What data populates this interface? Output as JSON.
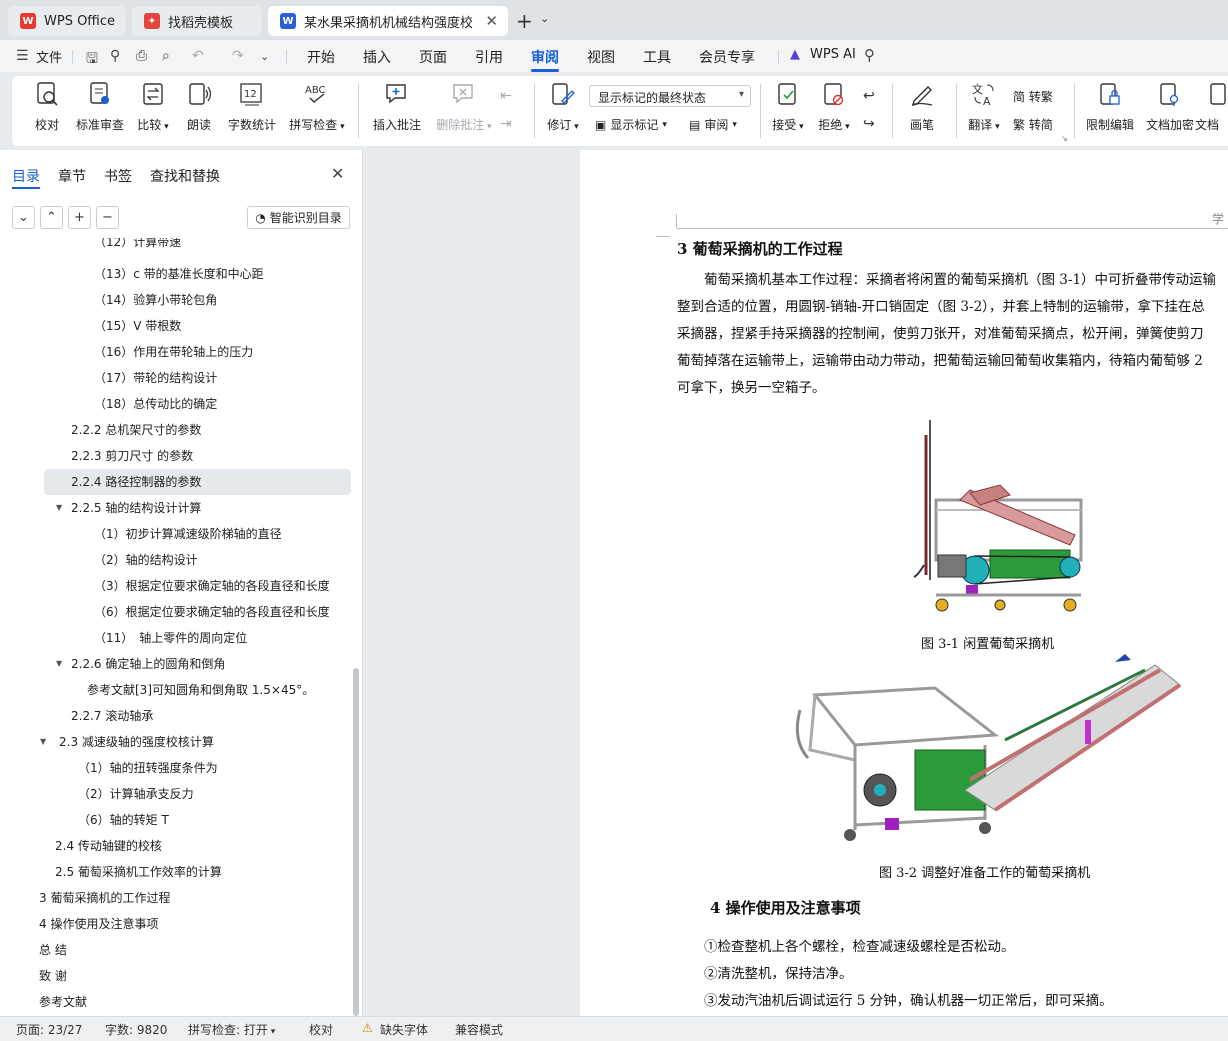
{
  "tabs": [
    {
      "label": "WPS Office",
      "icon": "wps-logo-icon"
    },
    {
      "label": "找稻壳模板",
      "icon": "docer-icon"
    },
    {
      "label": "某水果采摘机机械结构强度校核...",
      "icon": "word-doc-icon"
    }
  ],
  "menu": {
    "file": "文件",
    "items": [
      "开始",
      "插入",
      "页面",
      "引用",
      "审阅",
      "视图",
      "工具",
      "会员专享"
    ],
    "active": "审阅",
    "wps_ai": "WPS AI"
  },
  "ribbon": {
    "proofread": "校对",
    "std_review": "标准审查",
    "compare": "比较",
    "read_aloud": "朗读",
    "word_count": "字数统计",
    "spell_check": "拼写检查",
    "insert_comment": "插入批注",
    "delete_comment": "删除批注",
    "revise": "修订",
    "markup_state": "显示标记的最终状态",
    "show_markup": "显示标记",
    "review": "审阅",
    "accept": "接受",
    "reject": "拒绝",
    "pen": "画笔",
    "translate": "翻译",
    "to_trad": "简 转繁",
    "to_simp": "繁 转简",
    "restrict_edit": "限制编辑",
    "doc_encrypt": "文档加密",
    "doc_more": "文档"
  },
  "nav": {
    "tabs": [
      "目录",
      "章节",
      "书签",
      "查找和替换"
    ],
    "active_tab": "目录",
    "ai_toc": "智能识别目录",
    "toc": [
      {
        "text": "（12）计算带速",
        "level": 3
      },
      {
        "text": "（13）c 带的基准长度和中心距",
        "level": 3
      },
      {
        "text": "（14）验算小带轮包角",
        "level": 3
      },
      {
        "text": "（15）V 带根数",
        "level": 3
      },
      {
        "text": "（16）作用在带轮轴上的压力",
        "level": 3
      },
      {
        "text": "（17）带轮的结构设计",
        "level": 3
      },
      {
        "text": "（18）总传动比的确定",
        "level": 3
      },
      {
        "text": "2.2.2 总机架尺寸的参数",
        "level": 2
      },
      {
        "text": "2.2.3 剪刀尺寸 的参数",
        "level": 2
      },
      {
        "text": "2.2.4 路径控制器的参数",
        "level": 2,
        "selected": true
      },
      {
        "text": "2.2.5 轴的结构设计计算",
        "level": 2,
        "expanded": true
      },
      {
        "text": "（1）初步计算减速级阶梯轴的直径",
        "level": 3
      },
      {
        "text": "（2）轴的结构设计",
        "level": 3
      },
      {
        "text": "（3）根据定位要求确定轴的各段直径和长度",
        "level": 3
      },
      {
        "text": "（6）根据定位要求确定轴的各段直径和长度",
        "level": 3
      },
      {
        "text": "（11）　轴上零件的周向定位",
        "level": 3
      },
      {
        "text": "2.2.6  确定轴上的圆角和倒角",
        "level": 2,
        "expanded": true
      },
      {
        "text": "参考文献[3]可知圆角和倒角取 1.5×45°。",
        "level": "2b"
      },
      {
        "text": "2.2.7 滚动轴承",
        "level": 2
      },
      {
        "text": "2.3 减速级轴的强度校核计算",
        "level": 1,
        "expanded": true
      },
      {
        "text": "（1）轴的扭转强度条件为",
        "level": "1b"
      },
      {
        "text": "（2）计算轴承支反力",
        "level": "1b"
      },
      {
        "text": "（6）轴的转矩 T",
        "level": "1b"
      },
      {
        "text": "2.4 传动轴键的校核",
        "level": 1
      },
      {
        "text": "2.5 葡萄采摘机工作效率的计算",
        "level": 1
      },
      {
        "text": "3  葡萄采摘机的工作过程",
        "level": 0
      },
      {
        "text": "4  操作使用及注意事项",
        "level": 0
      },
      {
        "text": "总 结",
        "level": 0
      },
      {
        "text": "致 谢",
        "level": 0
      },
      {
        "text": "参考文献",
        "level": 0
      }
    ]
  },
  "doc": {
    "header_text": "学",
    "h3": "3  葡萄采摘机的工作过程",
    "p_lines": [
      "葡萄采摘机基本工作过程：采摘者将闲置的葡萄采摘机（图 3-1）中可折叠带传动运输",
      "整到合适的位置，用圆钢-销轴-开口销固定（图 3-2），并套上特制的运输带，拿下挂在总",
      "采摘器，捏紧手持采摘器的控制闸，使剪刀张开，对准葡萄采摘点，松开闸，弹簧使剪刀",
      "葡萄掉落在运输带上，运输带由动力带动，把葡萄运输回葡萄收集箱内，待箱内葡萄够 2",
      "可拿下，换另一空箱子。"
    ],
    "fig1_caption": "图 3-1 闲置葡萄采摘机",
    "fig2_caption": "图 3-2 调整好准备工作的葡萄采摘机",
    "h4": "4  操作使用及注意事项",
    "items": [
      "①检查整机上各个螺栓，检查减速级螺栓是否松动。",
      "②清洗整机，保持洁净。",
      "③发动汽油机后调试运行 5 分钟，确认机器一切正常后，即可采摘。"
    ]
  },
  "status": {
    "page": "页面: 23/27",
    "words": "字数: 9820",
    "spell": "拼写检查: 打开",
    "proof": "校对",
    "missing_font": "缺失字体",
    "compat": "兼容模式"
  },
  "colors": {
    "accent": "#1a5fd6",
    "wps_red": "#e8382f",
    "docer_red": "#e0443a",
    "word_blue": "#2b5fd8"
  }
}
